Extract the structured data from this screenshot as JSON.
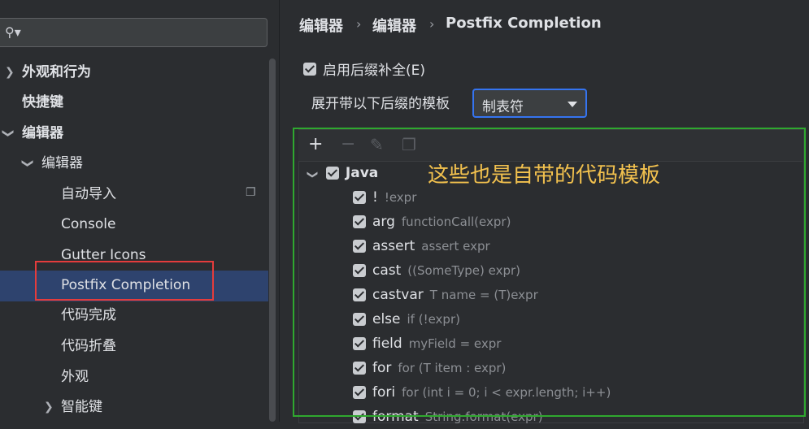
{
  "sidebar": {
    "search": {
      "icon": "search-icon",
      "value": ""
    },
    "items": [
      {
        "label": "外观和行为",
        "expandable": true,
        "expanded": false,
        "bold": true
      },
      {
        "label": "快捷键",
        "bold": true
      },
      {
        "label": "编辑器",
        "expandable": true,
        "expanded": true,
        "bold": true
      },
      {
        "label": "编辑器",
        "expandable": true,
        "expanded": true
      },
      {
        "label": "自动导入"
      },
      {
        "label": "Console"
      },
      {
        "label": "Gutter Icons"
      },
      {
        "label": "Postfix Completion",
        "selected": true
      },
      {
        "label": "代码完成"
      },
      {
        "label": "代码折叠"
      },
      {
        "label": "外观"
      },
      {
        "label": "智能键",
        "expandable": true,
        "expanded": false
      }
    ]
  },
  "breadcrumb": [
    "编辑器",
    "编辑器",
    "Postfix Completion"
  ],
  "settings": {
    "enable_label": "启用后缀补全(E)",
    "enable_checked": true,
    "expand_label": "展开带以下后缀的模板",
    "expand_value": "制表符"
  },
  "toolbar": {
    "add": "+",
    "remove": "−",
    "edit": "edit-icon",
    "copy": "copy-icon"
  },
  "tree": {
    "group": {
      "label": "Java",
      "checked": true
    },
    "templates": [
      {
        "key": "!",
        "example": "!expr"
      },
      {
        "key": "arg",
        "example": "functionCall(expr)"
      },
      {
        "key": "assert",
        "example": "assert expr"
      },
      {
        "key": "cast",
        "example": "((SomeType) expr)"
      },
      {
        "key": "castvar",
        "example": "T name = (T)expr"
      },
      {
        "key": "else",
        "example": "if (!expr)"
      },
      {
        "key": "field",
        "example": "myField = expr"
      },
      {
        "key": "for",
        "example": "for (T item : expr)"
      },
      {
        "key": "fori",
        "example": "for (int i = 0; i < expr.length; i++)"
      },
      {
        "key": "format",
        "example": "String.format(expr)"
      }
    ]
  },
  "annotation": "这些也是自带的代码模板",
  "colors": {
    "accent": "#3574f0",
    "selection": "#2e436e",
    "highlight_red": "#e43c3c",
    "highlight_green": "#2fa82f",
    "annotation": "#f2c14e"
  }
}
